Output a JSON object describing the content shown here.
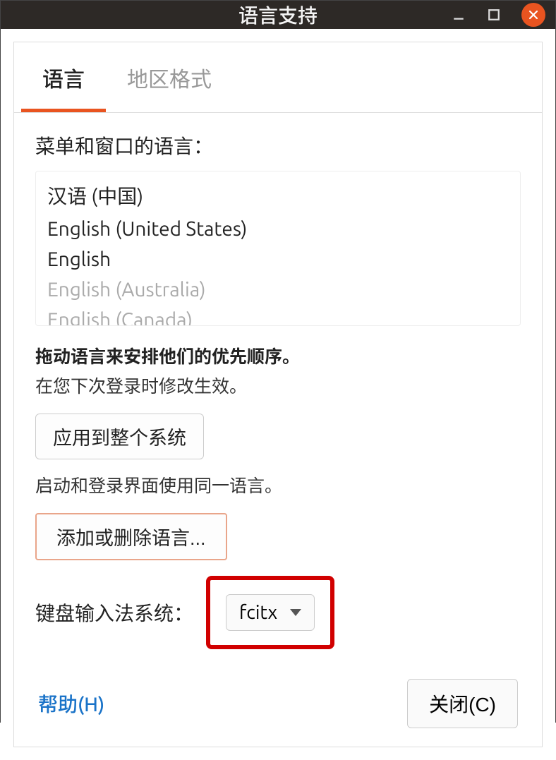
{
  "window": {
    "title": "语言支持"
  },
  "tabs": {
    "language": "语言",
    "region": "地区格式"
  },
  "panel": {
    "menu_window_lang_label": "菜单和窗口的语言：",
    "languages": [
      {
        "label": "汉语 (中国)",
        "dim": false
      },
      {
        "label": "English (United States)",
        "dim": false
      },
      {
        "label": "English",
        "dim": false
      },
      {
        "label": "English (Australia)",
        "dim": true
      },
      {
        "label": "English (Canada)",
        "dim": true
      }
    ],
    "drag_hint_bold": "拖动语言来安排他们的优先顺序。",
    "drag_hint": "在您下次登录时修改生效。",
    "apply_system_button": "应用到整个系统",
    "same_lang_hint": "启动和登录界面使用同一语言。",
    "add_remove_button": "添加或删除语言...",
    "ime_label": "键盘输入法系统：",
    "ime_value": "fcitx"
  },
  "footer": {
    "help": "帮助(H)",
    "close": "关闭(C)"
  }
}
